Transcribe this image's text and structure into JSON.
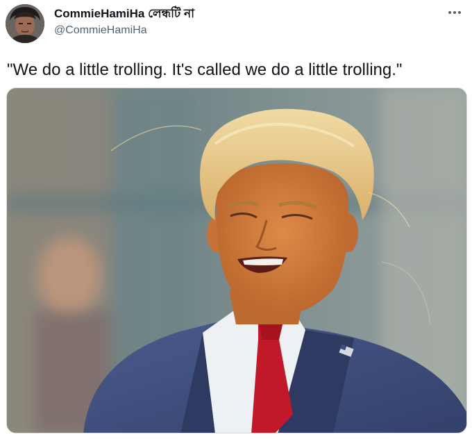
{
  "author": {
    "display_name": "CommieHamiHa লেন্ধটি না",
    "handle": "@CommieHamiHa",
    "avatar_icon": "avatar-photo"
  },
  "menu": {
    "more_icon": "more-options-icon"
  },
  "tweet": {
    "text": "\"We do a little trolling. It's called we do a little trolling.\""
  },
  "media": {
    "description_icon": "photo",
    "colors": {
      "background": "#7d8b87",
      "skin": "#d47d3e",
      "hair": "#e8c98a",
      "suit": "#3f4f7e",
      "tie": "#c2192a",
      "shirt": "#f2f4f6"
    }
  }
}
